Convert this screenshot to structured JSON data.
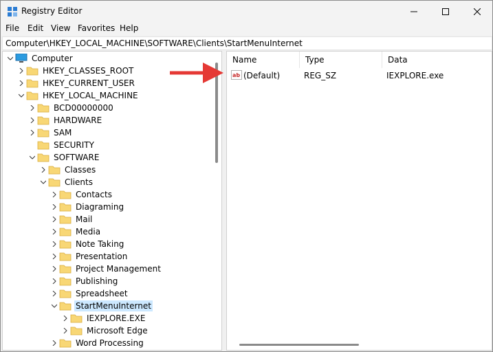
{
  "window": {
    "title": "Registry Editor",
    "app_icon": "registry-editor-icon"
  },
  "titlebar_buttons": {
    "minimize": "minimize-icon",
    "maximize": "maximize-icon",
    "close": "close-icon"
  },
  "menu": [
    "File",
    "Edit",
    "View",
    "Favorites",
    "Help"
  ],
  "address": "Computer\\HKEY_LOCAL_MACHINE\\SOFTWARE\\Clients\\StartMenuInternet",
  "tree": [
    {
      "label": "Computer",
      "expanded": true,
      "icon": "computer-icon"
    },
    {
      "label": "HKEY_CLASSES_ROOT",
      "expanded": false,
      "icon": "folder-icon"
    },
    {
      "label": "HKEY_CURRENT_USER",
      "expanded": false,
      "icon": "folder-icon"
    },
    {
      "label": "HKEY_LOCAL_MACHINE",
      "expanded": true,
      "icon": "folder-icon"
    },
    {
      "label": "BCD00000000",
      "expanded": false,
      "icon": "folder-icon"
    },
    {
      "label": "HARDWARE",
      "expanded": false,
      "icon": "folder-icon"
    },
    {
      "label": "SAM",
      "expanded": false,
      "icon": "folder-icon"
    },
    {
      "label": "SECURITY",
      "expanded": null,
      "icon": "folder-icon"
    },
    {
      "label": "SOFTWARE",
      "expanded": true,
      "icon": "folder-icon"
    },
    {
      "label": "Classes",
      "expanded": false,
      "icon": "folder-icon"
    },
    {
      "label": "Clients",
      "expanded": true,
      "icon": "folder-icon"
    },
    {
      "label": "Contacts",
      "expanded": false,
      "icon": "folder-icon"
    },
    {
      "label": "Diagraming",
      "expanded": false,
      "icon": "folder-icon"
    },
    {
      "label": "Mail",
      "expanded": false,
      "icon": "folder-icon"
    },
    {
      "label": "Media",
      "expanded": false,
      "icon": "folder-icon"
    },
    {
      "label": "Note Taking",
      "expanded": false,
      "icon": "folder-icon"
    },
    {
      "label": "Presentation",
      "expanded": false,
      "icon": "folder-icon"
    },
    {
      "label": "Project Management",
      "expanded": false,
      "icon": "folder-icon"
    },
    {
      "label": "Publishing",
      "expanded": false,
      "icon": "folder-icon"
    },
    {
      "label": "Spreadsheet",
      "expanded": false,
      "icon": "folder-icon"
    },
    {
      "label": "StartMenuInternet",
      "expanded": true,
      "icon": "folder-icon",
      "selected": true
    },
    {
      "label": "IEXPLORE.EXE",
      "expanded": false,
      "icon": "folder-icon"
    },
    {
      "label": "Microsoft Edge",
      "expanded": false,
      "icon": "folder-icon"
    },
    {
      "label": "Word Processing",
      "expanded": false,
      "icon": "folder-icon"
    }
  ],
  "list": {
    "columns": [
      "Name",
      "Type",
      "Data"
    ],
    "rows": [
      {
        "name": "(Default)",
        "type": "REG_SZ",
        "data": "IEXPLORE.exe",
        "icon": "string-value-icon"
      }
    ]
  },
  "colors": {
    "selection": "#cce8ff",
    "folder": "#f8d775",
    "arrow": "#e53935",
    "accent": "#0078d4"
  }
}
